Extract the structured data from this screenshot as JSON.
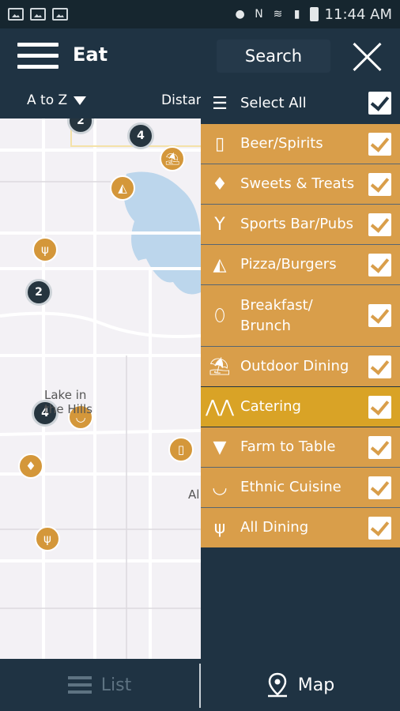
{
  "status_bar": {
    "time": "11:44 AM"
  },
  "app_bar": {
    "title": "Eat",
    "search_label": "Search"
  },
  "sort": {
    "order": "A to Z",
    "distance": "Distance"
  },
  "map": {
    "labels": [
      "Lake in",
      "the Hills",
      "Al"
    ],
    "clusters": [
      "2",
      "4",
      "2",
      "4"
    ]
  },
  "filters": {
    "select_all": "Select All",
    "items": [
      {
        "label": "Beer/Spirits",
        "icon": "mug-icon",
        "checked": true
      },
      {
        "label": "Sweets & Treats",
        "icon": "ice-cream-icon",
        "checked": true
      },
      {
        "label": "Sports Bar/Pubs",
        "icon": "cocktail-icon",
        "checked": true
      },
      {
        "label": "Pizza/Burgers",
        "icon": "pizza-icon",
        "checked": true
      },
      {
        "label": "Breakfast/",
        "label2": "Brunch",
        "icon": "egg-icon",
        "checked": true
      },
      {
        "label": "Outdoor Dining",
        "icon": "umbrella-table-icon",
        "checked": true
      },
      {
        "label": "Catering",
        "icon": "catering-icon",
        "checked": true
      },
      {
        "label": "Farm to Table",
        "icon": "carrot-icon",
        "checked": true
      },
      {
        "label": "Ethnic Cuisine",
        "icon": "bowl-icon",
        "checked": true
      },
      {
        "label": "All Dining",
        "icon": "utensils-icon",
        "checked": true
      }
    ]
  },
  "bottom_tabs": {
    "list": "List",
    "map": "Map"
  },
  "colors": {
    "header": "#1f3343",
    "filter_orange": "#d99e4a",
    "filter_active": "#d9a326",
    "pin": "#d4973a"
  }
}
